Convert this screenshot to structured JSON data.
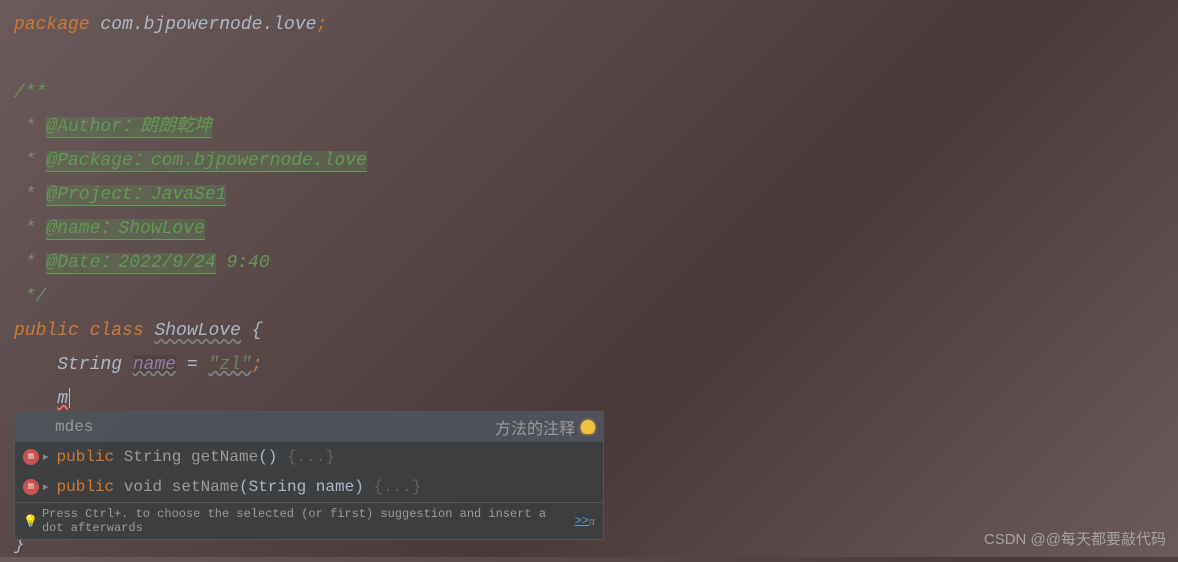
{
  "code": {
    "package_kw": "package",
    "package_name": " com.bjpowernode.love",
    "semicolon": ";",
    "doc_open": "/**",
    "star": " * ",
    "author_tag": "@Author：朗朗乾坤",
    "package_tag": "@Package：com.bjpowernode.love",
    "project_tag": "@Project：JavaSe1",
    "name_tag": "@name：ShowLove",
    "date_tag": "@Date：2022/9/24",
    "date_time": " 9:40",
    "doc_close": " */",
    "public_kw": "public ",
    "class_kw": "class ",
    "class_name": "ShowLove",
    "brace_open": " {",
    "indent": "    ",
    "string_type": "String ",
    "var_name": "name",
    "eq": " = ",
    "string_val": "\"zl\"",
    "typed": "m",
    "brace_close": "}"
  },
  "autocomplete": {
    "item1_label": "mdes",
    "item1_desc": "方法的注释",
    "item2_prefix": "public ",
    "item2_type": "String ",
    "item2_method": "getName",
    "item2_parens": "()",
    "item2_body": " {...}",
    "item3_prefix": "public ",
    "item3_type": "void ",
    "item3_method": "setName",
    "item3_params": "(String name)",
    "item3_body": " {...}",
    "hint_text": "Press Ctrl+. to choose the selected (or first) suggestion and insert a dot afterwards",
    "hint_link": ">>",
    "pi": "π"
  },
  "watermark": "CSDN @@每天都要敲代码"
}
